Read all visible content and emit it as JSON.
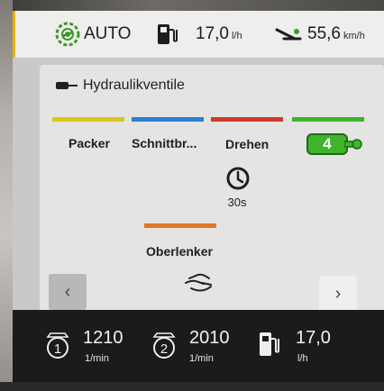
{
  "topbar": {
    "auto_label": "AUTO",
    "fuel_value": "17,0",
    "fuel_unit": "l/h",
    "speed_value": "55,6",
    "speed_unit": "km/h"
  },
  "panel": {
    "title": "Hydraulikventile",
    "valves": [
      {
        "label": "Packer",
        "color": "#d9c616"
      },
      {
        "label": "Schnittbr...",
        "color": "#2f7fd1"
      },
      {
        "label": "Drehen",
        "color": "#d23a2a"
      },
      {
        "label": "4",
        "color": "#3eb52c"
      },
      {
        "label": "Oberlenker",
        "color": "#e07a22"
      }
    ],
    "timer_label": "30s"
  },
  "nav": {
    "prev": "‹",
    "next": "›"
  },
  "bottom": {
    "engine1_value": "1210",
    "engine1_unit": "1/min",
    "engine2_value": "2010",
    "engine2_unit": "1/min",
    "fuel_value": "17,0",
    "fuel_unit": "l/h"
  },
  "icons": [
    "auto-mode-icon",
    "fuel-pump-icon",
    "speed-icon",
    "valve-icon",
    "clock-icon",
    "hand-icon",
    "engine-1-icon",
    "engine-2-icon"
  ]
}
